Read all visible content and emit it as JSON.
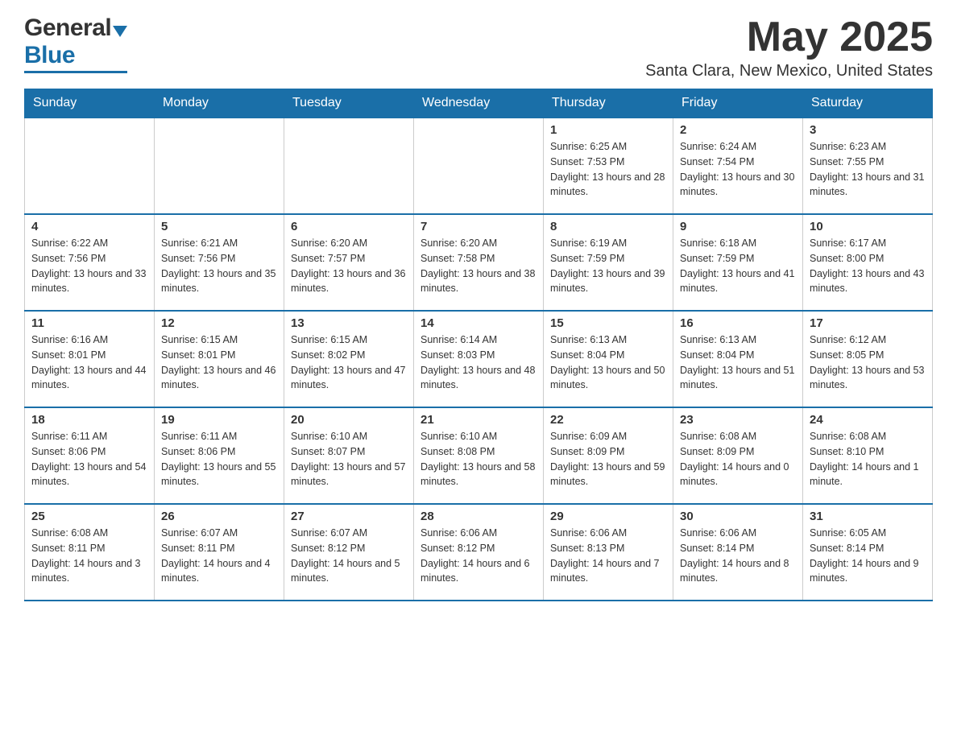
{
  "header": {
    "logo_general": "General",
    "logo_blue": "Blue",
    "month_title": "May 2025",
    "location": "Santa Clara, New Mexico, United States"
  },
  "days_of_week": [
    "Sunday",
    "Monday",
    "Tuesday",
    "Wednesday",
    "Thursday",
    "Friday",
    "Saturday"
  ],
  "weeks": [
    {
      "days": [
        {
          "number": "",
          "info": ""
        },
        {
          "number": "",
          "info": ""
        },
        {
          "number": "",
          "info": ""
        },
        {
          "number": "",
          "info": ""
        },
        {
          "number": "1",
          "info": "Sunrise: 6:25 AM\nSunset: 7:53 PM\nDaylight: 13 hours and 28 minutes."
        },
        {
          "number": "2",
          "info": "Sunrise: 6:24 AM\nSunset: 7:54 PM\nDaylight: 13 hours and 30 minutes."
        },
        {
          "number": "3",
          "info": "Sunrise: 6:23 AM\nSunset: 7:55 PM\nDaylight: 13 hours and 31 minutes."
        }
      ]
    },
    {
      "days": [
        {
          "number": "4",
          "info": "Sunrise: 6:22 AM\nSunset: 7:56 PM\nDaylight: 13 hours and 33 minutes."
        },
        {
          "number": "5",
          "info": "Sunrise: 6:21 AM\nSunset: 7:56 PM\nDaylight: 13 hours and 35 minutes."
        },
        {
          "number": "6",
          "info": "Sunrise: 6:20 AM\nSunset: 7:57 PM\nDaylight: 13 hours and 36 minutes."
        },
        {
          "number": "7",
          "info": "Sunrise: 6:20 AM\nSunset: 7:58 PM\nDaylight: 13 hours and 38 minutes."
        },
        {
          "number": "8",
          "info": "Sunrise: 6:19 AM\nSunset: 7:59 PM\nDaylight: 13 hours and 39 minutes."
        },
        {
          "number": "9",
          "info": "Sunrise: 6:18 AM\nSunset: 7:59 PM\nDaylight: 13 hours and 41 minutes."
        },
        {
          "number": "10",
          "info": "Sunrise: 6:17 AM\nSunset: 8:00 PM\nDaylight: 13 hours and 43 minutes."
        }
      ]
    },
    {
      "days": [
        {
          "number": "11",
          "info": "Sunrise: 6:16 AM\nSunset: 8:01 PM\nDaylight: 13 hours and 44 minutes."
        },
        {
          "number": "12",
          "info": "Sunrise: 6:15 AM\nSunset: 8:01 PM\nDaylight: 13 hours and 46 minutes."
        },
        {
          "number": "13",
          "info": "Sunrise: 6:15 AM\nSunset: 8:02 PM\nDaylight: 13 hours and 47 minutes."
        },
        {
          "number": "14",
          "info": "Sunrise: 6:14 AM\nSunset: 8:03 PM\nDaylight: 13 hours and 48 minutes."
        },
        {
          "number": "15",
          "info": "Sunrise: 6:13 AM\nSunset: 8:04 PM\nDaylight: 13 hours and 50 minutes."
        },
        {
          "number": "16",
          "info": "Sunrise: 6:13 AM\nSunset: 8:04 PM\nDaylight: 13 hours and 51 minutes."
        },
        {
          "number": "17",
          "info": "Sunrise: 6:12 AM\nSunset: 8:05 PM\nDaylight: 13 hours and 53 minutes."
        }
      ]
    },
    {
      "days": [
        {
          "number": "18",
          "info": "Sunrise: 6:11 AM\nSunset: 8:06 PM\nDaylight: 13 hours and 54 minutes."
        },
        {
          "number": "19",
          "info": "Sunrise: 6:11 AM\nSunset: 8:06 PM\nDaylight: 13 hours and 55 minutes."
        },
        {
          "number": "20",
          "info": "Sunrise: 6:10 AM\nSunset: 8:07 PM\nDaylight: 13 hours and 57 minutes."
        },
        {
          "number": "21",
          "info": "Sunrise: 6:10 AM\nSunset: 8:08 PM\nDaylight: 13 hours and 58 minutes."
        },
        {
          "number": "22",
          "info": "Sunrise: 6:09 AM\nSunset: 8:09 PM\nDaylight: 13 hours and 59 minutes."
        },
        {
          "number": "23",
          "info": "Sunrise: 6:08 AM\nSunset: 8:09 PM\nDaylight: 14 hours and 0 minutes."
        },
        {
          "number": "24",
          "info": "Sunrise: 6:08 AM\nSunset: 8:10 PM\nDaylight: 14 hours and 1 minute."
        }
      ]
    },
    {
      "days": [
        {
          "number": "25",
          "info": "Sunrise: 6:08 AM\nSunset: 8:11 PM\nDaylight: 14 hours and 3 minutes."
        },
        {
          "number": "26",
          "info": "Sunrise: 6:07 AM\nSunset: 8:11 PM\nDaylight: 14 hours and 4 minutes."
        },
        {
          "number": "27",
          "info": "Sunrise: 6:07 AM\nSunset: 8:12 PM\nDaylight: 14 hours and 5 minutes."
        },
        {
          "number": "28",
          "info": "Sunrise: 6:06 AM\nSunset: 8:12 PM\nDaylight: 14 hours and 6 minutes."
        },
        {
          "number": "29",
          "info": "Sunrise: 6:06 AM\nSunset: 8:13 PM\nDaylight: 14 hours and 7 minutes."
        },
        {
          "number": "30",
          "info": "Sunrise: 6:06 AM\nSunset: 8:14 PM\nDaylight: 14 hours and 8 minutes."
        },
        {
          "number": "31",
          "info": "Sunrise: 6:05 AM\nSunset: 8:14 PM\nDaylight: 14 hours and 9 minutes."
        }
      ]
    }
  ]
}
